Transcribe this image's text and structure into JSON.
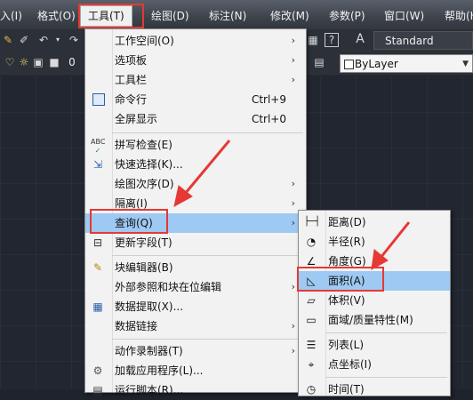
{
  "menubar": {
    "items": [
      {
        "label": "入(I)"
      },
      {
        "label": "格式(O)"
      },
      {
        "label": "工具(T)"
      },
      {
        "label": "绘图(D)"
      },
      {
        "label": "标注(N)"
      },
      {
        "label": "修改(M)"
      },
      {
        "label": "参数(P)"
      },
      {
        "label": "窗口(W)"
      },
      {
        "label": "帮助(H"
      }
    ]
  },
  "toolbar": {
    "style_combo": "Standard",
    "layer_combo": "ByLayer",
    "layer_prefix": "0"
  },
  "tools_menu": {
    "items": [
      {
        "label": "工作空间(O)",
        "shortcut": "",
        "submenu": true
      },
      {
        "label": "选项板",
        "shortcut": "",
        "submenu": true
      },
      {
        "label": "工具栏",
        "shortcut": "",
        "submenu": true
      },
      {
        "label": "命令行",
        "shortcut": "Ctrl+9",
        "submenu": false
      },
      {
        "label": "全屏显示",
        "shortcut": "Ctrl+0",
        "submenu": false
      },
      {
        "label": "拼写检查(E)",
        "shortcut": "",
        "submenu": false
      },
      {
        "label": "快速选择(K)...",
        "shortcut": "",
        "submenu": false
      },
      {
        "label": "绘图次序(D)",
        "shortcut": "",
        "submenu": true
      },
      {
        "label": "隔离(I)",
        "shortcut": "",
        "submenu": true
      },
      {
        "label": "查询(Q)",
        "shortcut": "",
        "submenu": true
      },
      {
        "label": "更新字段(T)",
        "shortcut": "",
        "submenu": false
      },
      {
        "label": "块编辑器(B)",
        "shortcut": "",
        "submenu": false
      },
      {
        "label": "外部参照和块在位编辑",
        "shortcut": "",
        "submenu": true
      },
      {
        "label": "数据提取(X)...",
        "shortcut": "",
        "submenu": false
      },
      {
        "label": "数据链接",
        "shortcut": "",
        "submenu": true
      },
      {
        "label": "动作录制器(T)",
        "shortcut": "",
        "submenu": true
      },
      {
        "label": "加载应用程序(L)...",
        "shortcut": "",
        "submenu": false
      },
      {
        "label": "运行脚本(R)...",
        "shortcut": "",
        "submenu": false
      }
    ]
  },
  "query_menu": {
    "items": [
      {
        "label": "距离(D)"
      },
      {
        "label": "半径(R)"
      },
      {
        "label": "角度(G)"
      },
      {
        "label": "面积(A)"
      },
      {
        "label": "体积(V)"
      },
      {
        "label": "面域/质量特性(M)"
      },
      {
        "label": "列表(L)"
      },
      {
        "label": "点坐标(I)"
      },
      {
        "label": "时间(T)"
      }
    ]
  },
  "colors": {
    "highlight": "#9ec9f2",
    "annotation": "#e53935",
    "menubar": "#44484f",
    "canvas": "#212631"
  }
}
